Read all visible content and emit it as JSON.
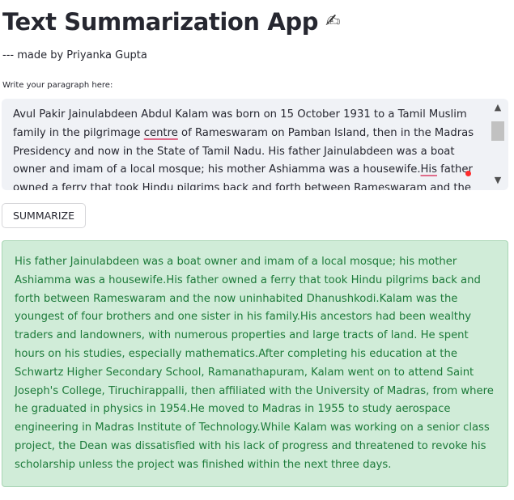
{
  "app": {
    "title": "Text Summarization App",
    "title_emoji": "✍",
    "byline": "--- made by Priyanka Gupta"
  },
  "input": {
    "label": "Write your paragraph here:",
    "line1": "Avul Pakir Jainulabdeen Abdul Kalam was born on 15 October 1931 to a Tamil Muslim",
    "line2_a": "family in the pilgrimage ",
    "line2_b": "centre",
    "line2_c": " of Rameswaram on Pamban Island, then in the Madras",
    "line3": "Presidency and now in the State of Tamil Nadu. His father Jainulabdeen was a boat",
    "line4_a": "owner and imam of a local mosque; his mother Ashiamma was a housewife.",
    "line4_b": "His",
    "line4_c": " father",
    "line5": "owned a ferry that took Hindu pilgrims back and forth between Rameswaram and the",
    "scroll_up_icon": "▲",
    "scroll_down_icon": "▼"
  },
  "button": {
    "summarize_label": "SUMMARIZE"
  },
  "result": {
    "text": "His father Jainulabdeen was a boat owner and imam of a local mosque; his mother Ashiamma was a housewife.His father owned a ferry that took Hindu pilgrims back and forth between Rameswaram and the now uninhabited Dhanushkodi.Kalam was the youngest of four brothers and one sister in his family.His ancestors had been wealthy traders and landowners, with numerous properties and large tracts of land. He spent hours on his studies, especially mathematics.After completing his education at the Schwartz Higher Secondary School, Ramanathapuram, Kalam went on to attend Saint Joseph's College, Tiruchirappalli, then affiliated with the University of Madras, from where he graduated in physics in 1954.He moved to Madras in 1955 to study aerospace engineering in Madras Institute of Technology.While Kalam was working on a senior class project, the Dean was dissatisfied with his lack of progress and threatened to revoke his scholarship unless the project was finished within the next three days."
  },
  "colors": {
    "text": "#262730",
    "input_background": "#f0f2f6",
    "success_background": "#d0ecd8",
    "success_text": "#1d7a3a",
    "accent_dot": "#ff2b2b"
  }
}
